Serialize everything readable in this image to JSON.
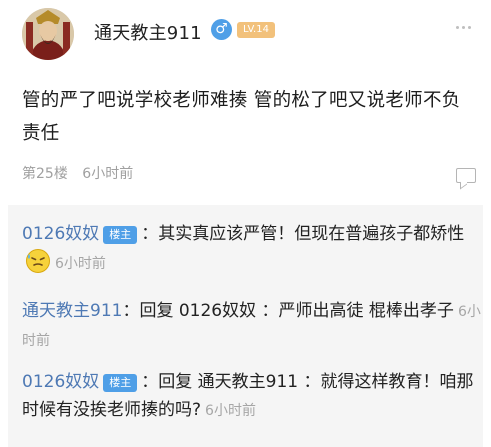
{
  "header": {
    "username": "通天教主911",
    "gender_symbol": "♂",
    "level_badge": "LV.14"
  },
  "post": {
    "body": "管的严了吧说学校老师难揍 管的松了吧又说老师不负责任",
    "floor": "第25楼",
    "time": "6小时前"
  },
  "replies": [
    {
      "name": "0126奴奴",
      "badge": "楼主",
      "text": "其实真应该严管！但现在普遍孩子都矫性",
      "time": "6小时前"
    },
    {
      "name": "通天教主911",
      "text": "回复 0126奴奴 ：严师出高徒 棍棒出孝子",
      "time": "6小时前"
    },
    {
      "name": "0126奴奴",
      "badge": "楼主",
      "text": "回复 通天教主911 ：就得这样教育！咱那时候有没挨老师揍的吗?",
      "time": "6小时前"
    }
  ],
  "colors": {
    "name_link": "#4e79b4",
    "owner_badge": "#4f9fe7",
    "level_badge": "#f2c17b",
    "gender_badge": "#4f9fe7"
  }
}
